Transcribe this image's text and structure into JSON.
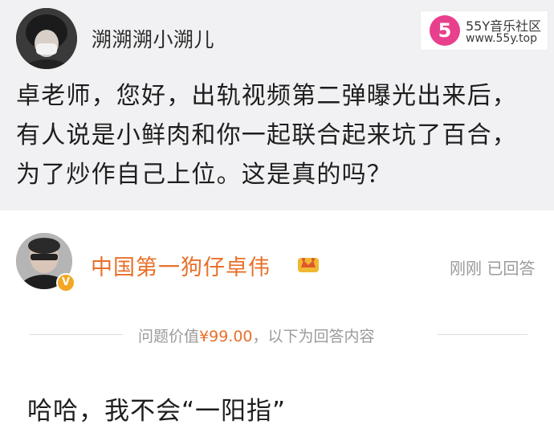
{
  "question": {
    "asker_name": "溯溯溯小溯儿",
    "text": "卓老师，您好，出轨视频第二弹曝光出来后，有人说是小鲜肉和你一起联合起来坑了百合，为了炒作自己上位。这是真的吗？"
  },
  "watermark": {
    "logo_text": "5",
    "title": "55Y音乐社区",
    "url": "www.55y.top"
  },
  "answer": {
    "answerer_name": "中国第一狗仔卓伟",
    "status": "刚刚 已回答",
    "value_prefix": "问题价值",
    "value_price": "¥99.00",
    "value_suffix": "，以下为回答内容",
    "text": "哈哈，我不会“一阳指”"
  },
  "colors": {
    "accent": "#e8702a",
    "watermark_logo": "#e8408c",
    "question_bg": "#f1f1f3",
    "muted": "#9a9a9a"
  },
  "icons": [
    "asker-avatar",
    "watermark-logo-icon",
    "answerer-avatar",
    "verified-badge-icon",
    "crown-icon"
  ]
}
